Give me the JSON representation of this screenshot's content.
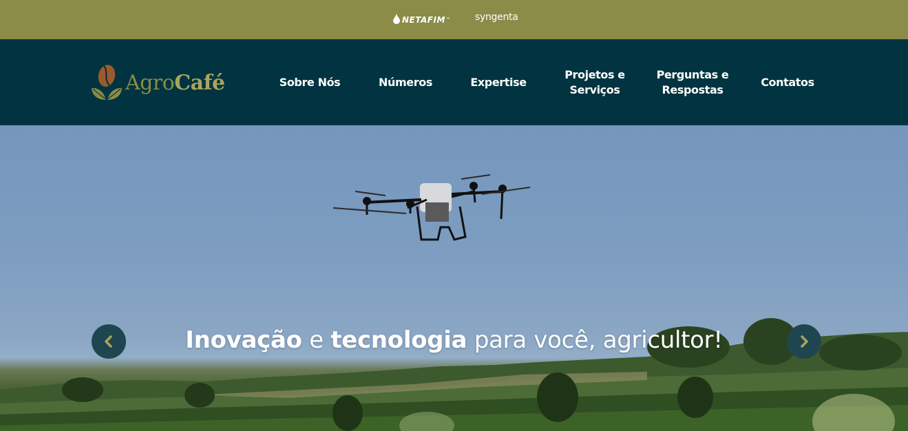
{
  "sponsors": {
    "netafim": "NETAFIM",
    "netafim_tm": "™",
    "syngenta": "syngenta"
  },
  "logo": {
    "agro": "Agro",
    "cafe": "Café"
  },
  "nav": [
    {
      "label": "Sobre Nós"
    },
    {
      "label": "Números"
    },
    {
      "label": "Expertise"
    },
    {
      "label": "Projetos e\nServiços"
    },
    {
      "label": "Perguntas e\nRespostas"
    },
    {
      "label": "Contatos"
    }
  ],
  "hero": {
    "caption_part1": "Inovação",
    "caption_part2": " e ",
    "caption_part3": "tecnologia",
    "caption_part4": " para você, agricultor!"
  },
  "colors": {
    "topbar": "#8a8c48",
    "navbar": "#013440",
    "arrow": "#1f4650",
    "accent": "#a8a45e"
  },
  "icons": {
    "prev": "chevron-left-icon",
    "next": "chevron-right-icon",
    "drop": "water-drop-icon"
  }
}
